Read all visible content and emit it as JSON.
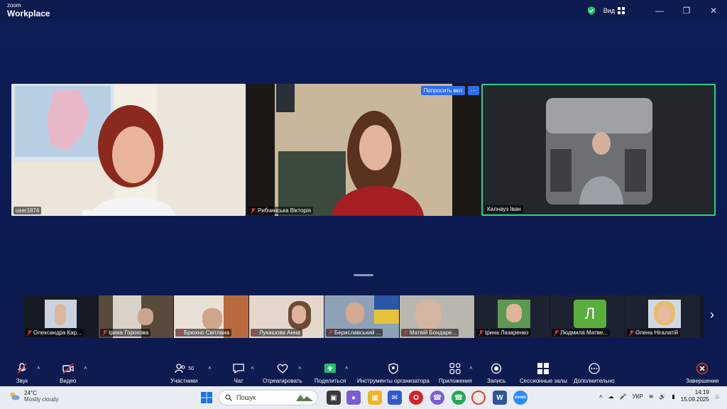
{
  "app": {
    "brand_small": "zoom",
    "brand_name": "Workplace",
    "view_label": "Вид"
  },
  "main_tiles": [
    {
      "name": "user1874"
    },
    {
      "name": "Рибчинська Вікторія",
      "ask_unmute": "Попросить вкл",
      "more": "···"
    },
    {
      "name": "Калнауз Іван"
    }
  ],
  "strip": [
    {
      "name": "Олександра Кар..."
    },
    {
      "name": "Ірина Горохова"
    },
    {
      "name": "Брюхно Світлана"
    },
    {
      "name": "Лукашова Анна"
    },
    {
      "name": "Бериславський ..."
    },
    {
      "name": "Матвій Бондаре..."
    },
    {
      "name": "Ірина Лазаренко"
    },
    {
      "name": "Людмила Матве...",
      "initial": "Л"
    },
    {
      "name": "Олена Нігалатій"
    }
  ],
  "toolbar": {
    "audio": "Звук",
    "video": "Видео",
    "participants": "Участники",
    "participants_count": "50",
    "chat": "Чат",
    "react": "Отреагировать",
    "share": "Поделиться",
    "host_tools": "Инструменты организатора",
    "apps": "Приложения",
    "record": "Запись",
    "breakout": "Сессионные залы",
    "more": "Дополнительно",
    "end": "Завершение"
  },
  "taskbar": {
    "temp": "24°C",
    "weather": "Mostly cloudy",
    "search_placeholder": "Пошук",
    "lang": "УКР",
    "time": "14:19",
    "date": "15.09.2025"
  },
  "colors": {
    "accent_green": "#2bd47a",
    "mic_off_red": "#e0353a",
    "share_green": "#1fbf6a"
  }
}
